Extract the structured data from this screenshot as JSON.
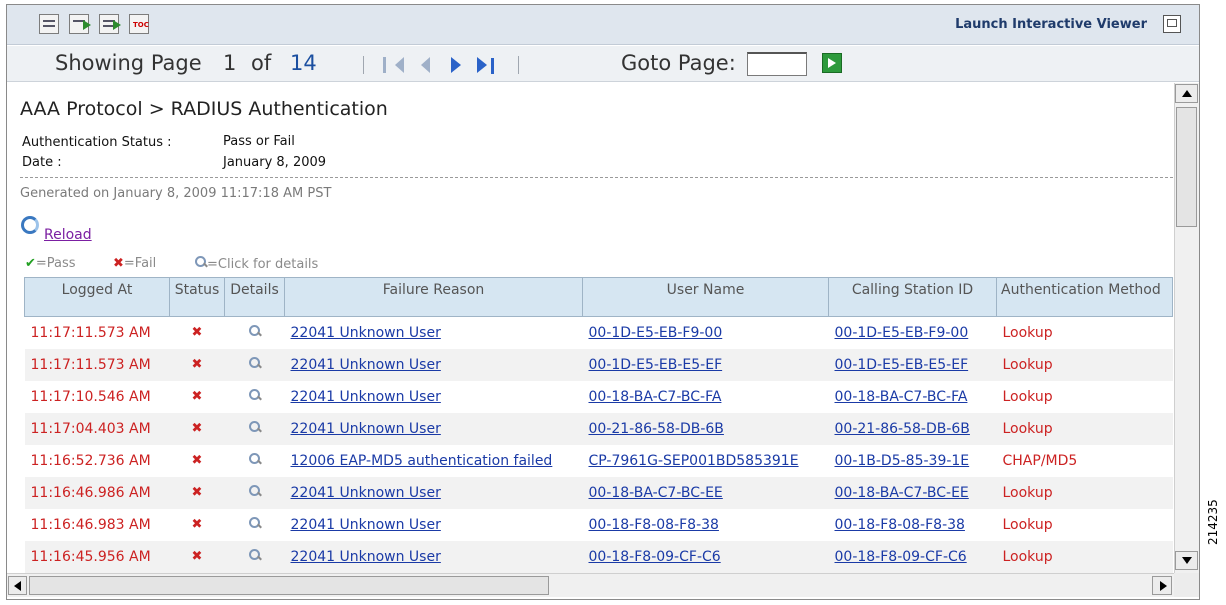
{
  "toolbar": {
    "icons": [
      "print-icon",
      "export-icon",
      "export-data-icon",
      "toc-icon"
    ],
    "toc_label": "TOC",
    "launch_label": "Launch Interactive Viewer"
  },
  "pager": {
    "showing_label": "Showing Page",
    "current_page": "1",
    "of_label": "of",
    "total_pages": "14",
    "goto_label": "Goto Page:",
    "goto_value": ""
  },
  "report": {
    "title": "AAA Protocol > RADIUS Authentication",
    "params": [
      {
        "label": "Authentication Status :",
        "value": "Pass or Fail"
      },
      {
        "label": "Date :",
        "value": "January 8, 2009"
      }
    ],
    "generated": "Generated on January 8, 2009 11:17:18 AM PST",
    "reload_label": "Reload",
    "legend": {
      "pass": "=Pass",
      "fail": "=Fail",
      "details": "=Click for details"
    }
  },
  "table": {
    "columns": [
      "Logged At",
      "Status",
      "Details",
      "Failure  Reason",
      "User Name",
      "Calling Station ID",
      "Authentication Method"
    ],
    "rows": [
      {
        "time": "11:17:11.573 AM",
        "reason": "22041 Unknown User",
        "user": "00-1D-E5-EB-F9-00",
        "station": "00-1D-E5-EB-F9-00",
        "method": "Lookup"
      },
      {
        "time": "11:17:11.573 AM",
        "reason": "22041 Unknown User",
        "user": "00-1D-E5-EB-E5-EF",
        "station": "00-1D-E5-EB-E5-EF",
        "method": "Lookup"
      },
      {
        "time": "11:17:10.546 AM",
        "reason": "22041 Unknown User",
        "user": "00-18-BA-C7-BC-FA",
        "station": "00-18-BA-C7-BC-FA",
        "method": "Lookup"
      },
      {
        "time": "11:17:04.403 AM",
        "reason": "22041 Unknown User",
        "user": "00-21-86-58-DB-6B",
        "station": "00-21-86-58-DB-6B",
        "method": "Lookup"
      },
      {
        "time": "11:16:52.736 AM",
        "reason": "12006 EAP-MD5 authentication failed",
        "user": "CP-7961G-SEP001BD585391E",
        "station": "00-1B-D5-85-39-1E",
        "method": "CHAP/MD5"
      },
      {
        "time": "11:16:46.986 AM",
        "reason": "22041 Unknown User",
        "user": "00-18-BA-C7-BC-EE",
        "station": "00-18-BA-C7-BC-EE",
        "method": "Lookup"
      },
      {
        "time": "11:16:46.983 AM",
        "reason": "22041 Unknown User",
        "user": "00-18-F8-08-F8-38",
        "station": "00-18-F8-08-F8-38",
        "method": "Lookup"
      },
      {
        "time": "11:16:45.956 AM",
        "reason": "22041 Unknown User",
        "user": "00-18-F8-09-CF-C6",
        "station": "00-18-F8-09-CF-C6",
        "method": "Lookup"
      }
    ]
  },
  "figure_code": "214235"
}
